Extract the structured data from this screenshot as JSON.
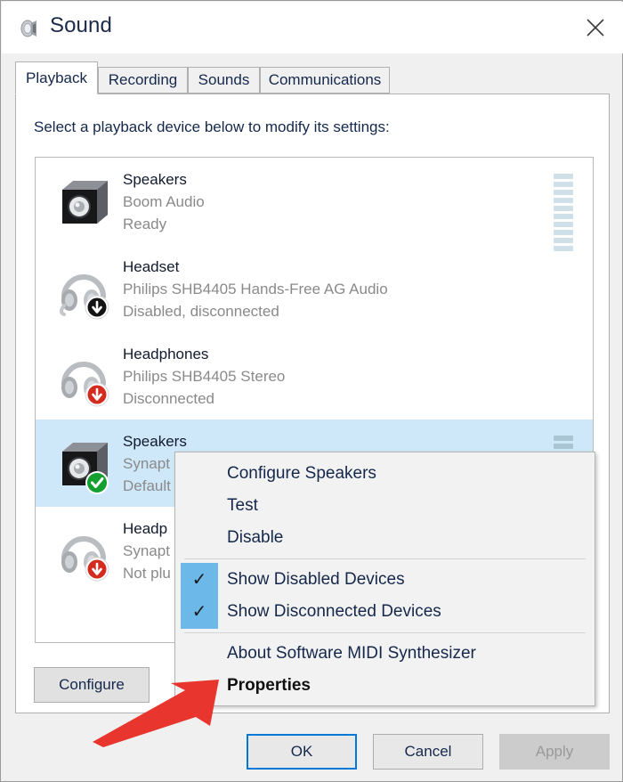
{
  "window": {
    "title": "Sound",
    "title_icon": "speaker-icon",
    "close_icon": "close-icon"
  },
  "tabs": [
    {
      "label": "Playback",
      "active": true
    },
    {
      "label": "Recording",
      "active": false
    },
    {
      "label": "Sounds",
      "active": false
    },
    {
      "label": "Communications",
      "active": false
    }
  ],
  "main": {
    "instruction": "Select a playback device below to modify its settings:"
  },
  "devices": [
    {
      "name": "Speakers",
      "driver": "Boom Audio",
      "status": "Ready",
      "icon": "speaker-icon",
      "badge": "none",
      "selected": false,
      "meter_segments": 10
    },
    {
      "name": "Headset",
      "driver": "Philips SHB4405 Hands-Free AG Audio",
      "status": "Disabled, disconnected",
      "icon": "headset-icon",
      "badge": "down-arrow-black-icon",
      "selected": false,
      "meter_segments": 0
    },
    {
      "name": "Headphones",
      "driver": "Philips SHB4405 Stereo",
      "status": "Disconnected",
      "icon": "headphones-icon",
      "badge": "down-arrow-red-icon",
      "selected": false,
      "meter_segments": 0
    },
    {
      "name": "Speakers",
      "driver": "Synapt",
      "status": "Default",
      "icon": "speaker-icon",
      "badge": "green-check-icon",
      "selected": true,
      "meter_segments": 3
    },
    {
      "name": "Headp",
      "driver": "Synapt",
      "status": "Not plu",
      "icon": "headphones-icon",
      "badge": "down-arrow-red-icon",
      "selected": false,
      "meter_segments": 0
    }
  ],
  "context_menu": {
    "items": [
      {
        "label": "Configure Speakers",
        "checked": false,
        "bold": false
      },
      {
        "label": "Test",
        "checked": false,
        "bold": false
      },
      {
        "label": "Disable",
        "checked": false,
        "bold": false
      },
      {
        "label": "Show Disabled Devices",
        "checked": true,
        "bold": false
      },
      {
        "label": "Show Disconnected Devices",
        "checked": true,
        "bold": false
      },
      {
        "label": "About Software MIDI Synthesizer",
        "checked": false,
        "bold": false
      },
      {
        "label": "Properties",
        "checked": false,
        "bold": true
      }
    ],
    "check_glyph": "✓"
  },
  "buttons": {
    "configure": "Configure",
    "ok": "OK",
    "cancel": "Cancel",
    "apply": "Apply"
  },
  "annotation": {
    "arrow_color": "#e8352e",
    "points_to": "Properties"
  },
  "colors": {
    "selection_blue": "#cfe8f9",
    "menu_check_blue": "#6cb8e8",
    "focus_blue": "#0078d7",
    "title_text": "#1b2a4a",
    "muted_text": "#8a8a8a"
  }
}
